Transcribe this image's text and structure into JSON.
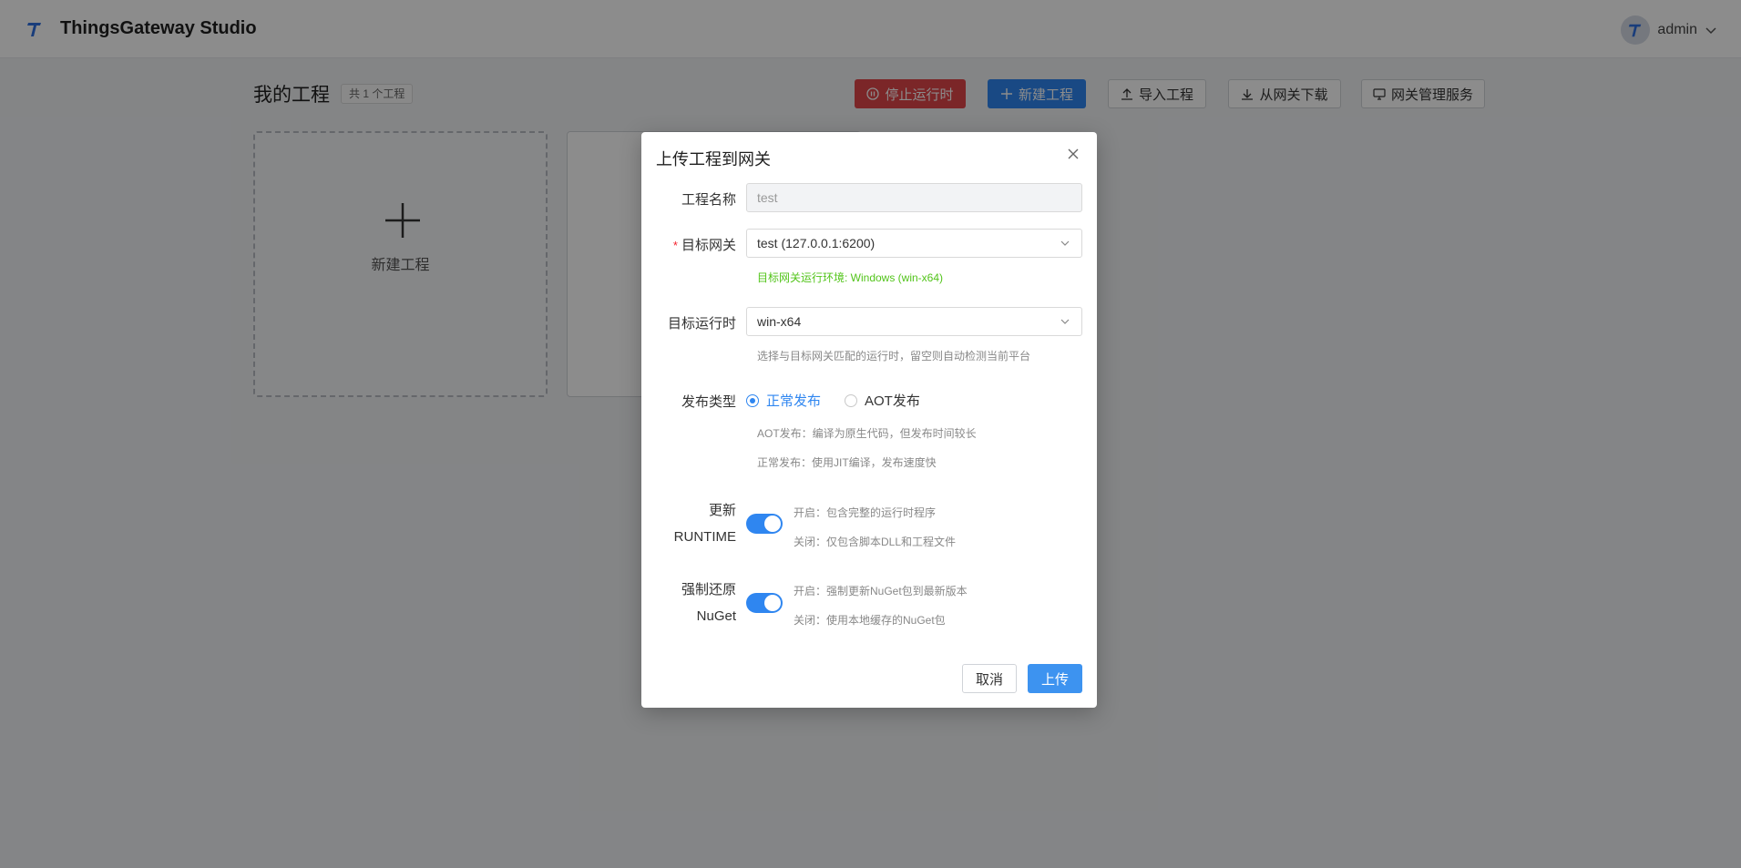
{
  "app": {
    "title": "ThingsGateway Studio",
    "user": "admin"
  },
  "page": {
    "title": "我的工程",
    "count": "共 1 个工程"
  },
  "toolbar": {
    "stop": "停止运行时",
    "new": "新建工程",
    "import": "导入工程",
    "download": "从网关下载",
    "manage": "网关管理服务"
  },
  "cards": {
    "new_label": "新建工程"
  },
  "dialog": {
    "title": "上传工程到网关",
    "name_label": "工程名称",
    "name_value": "test",
    "gateway_label": "目标网关",
    "gateway_value": "test (127.0.0.1:6200)",
    "gateway_env": "目标网关运行环境: Windows (win-x64)",
    "runtime_label": "目标运行时",
    "runtime_value": "win-x64",
    "runtime_hint": "选择与目标网关匹配的运行时，留空则自动检测当前平台",
    "publish_label": "发布类型",
    "publish_normal": "正常发布",
    "publish_aot": "AOT发布",
    "publish_selected": "正常发布",
    "publish_hint_aot": "AOT发布：编译为原生代码，但发布时间较长",
    "publish_hint_normal": "正常发布：使用JIT编译，发布速度快",
    "update_label_1": "更新",
    "update_label_2": "RUNTIME",
    "update_on": "开启：包含完整的运行时程序",
    "update_off": "关闭：仅包含脚本DLL和工程文件",
    "update_enabled": true,
    "nuget_label_1": "强制还原",
    "nuget_label_2": "NuGet",
    "nuget_on": "开启：强制更新NuGet包到最新版本",
    "nuget_off": "关闭：使用本地缓存的NuGet包",
    "nuget_enabled": true,
    "cancel": "取消",
    "upload": "上传"
  }
}
